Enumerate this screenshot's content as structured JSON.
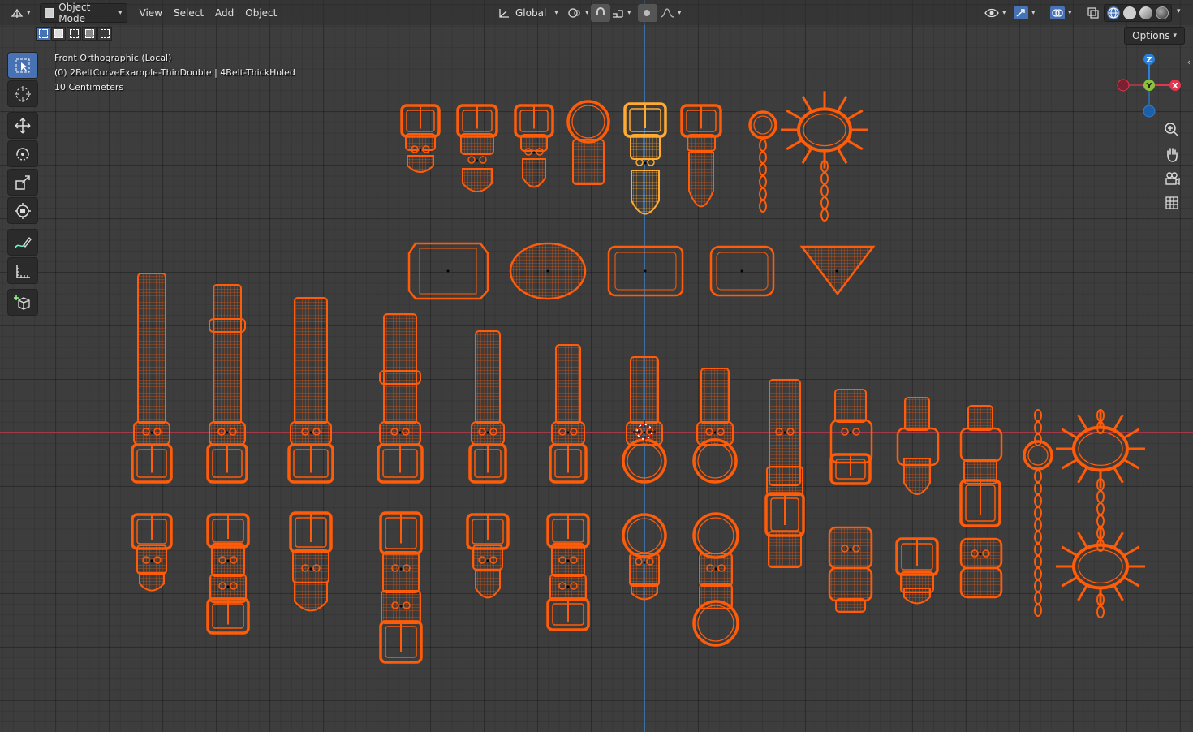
{
  "header": {
    "editor_type_icon": "view3d-icon",
    "mode_label": "Object Mode",
    "menus": [
      "View",
      "Select",
      "Add",
      "Object"
    ],
    "orientation_label": "Global",
    "pivot_icon": "pivot-point-icon",
    "snap_icon": "snap-magnet-icon",
    "proportional_icon": "proportional-edit-icon",
    "visibility_icon": "eye-icon",
    "gizmo_toggle_icon": "gizmo-icon",
    "overlay_toggle_icon": "overlay-icon",
    "xray_icon": "xray-icon",
    "shading_modes": [
      "wireframe",
      "solid",
      "material",
      "rendered"
    ]
  },
  "options_label": "Options",
  "viewport_info": {
    "view_name": "Front Orthographic (Local)",
    "object_line": "(0) 2BeltCurveExample-ThinDouble | 4Belt-ThickHoled",
    "scale_line": "10 Centimeters"
  },
  "toolbar": {
    "tools": [
      "select-box",
      "cursor",
      "move",
      "rotate",
      "scale",
      "transform",
      "annotate",
      "measure",
      "add-cube"
    ]
  },
  "gizmo": {
    "axes": [
      "Z",
      "Y",
      "X"
    ]
  },
  "nav_buttons": [
    "zoom-icon",
    "hand-pan-icon",
    "camera-icon",
    "grid-icon"
  ],
  "colors": {
    "selected_wire": "#ff5c0a",
    "active_wire": "#ffaa33",
    "x_axis": "#a2394a",
    "z_axis": "#3c6fa4",
    "gizmo_x": "#e2374f",
    "gizmo_y": "#8bc43a",
    "gizmo_z": "#2a7fd8",
    "accent": "#4772b3"
  }
}
